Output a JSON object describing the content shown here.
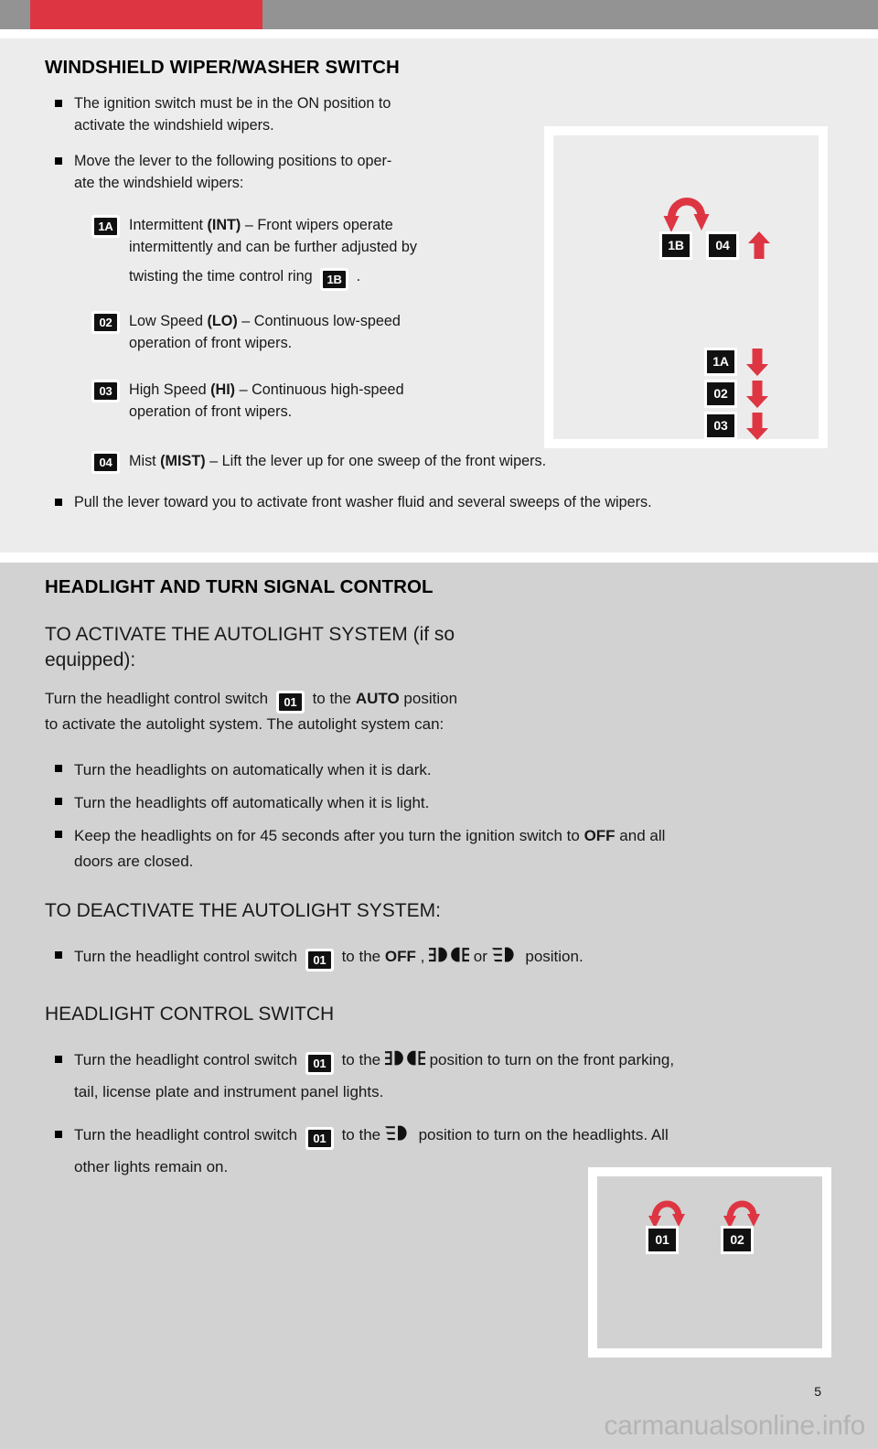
{
  "header": {
    "bar_color": "#939393",
    "accent_color": "#de3543"
  },
  "wiper_section": {
    "title": "WINDSHIELD WIPER/WASHER SWITCH",
    "bullets": [
      {
        "text_1": "The ignition switch must be in the ON position to",
        "text_2": "activate the windshield wipers."
      },
      {
        "text_1": "Move the lever to the following positions to oper-",
        "text_2": "ate the windshield wipers:"
      }
    ],
    "positions": [
      {
        "badge": "1A",
        "line_1_a": "Intermittent ",
        "line_1_bold": "(INT)",
        "line_1_b": " – Front wipers operate",
        "line_2": "intermittently and can be further adjusted by",
        "line_3_a": "twisting the time control ring",
        "inline_badge": "1B",
        "line_3_b": "."
      },
      {
        "badge": "02",
        "line_1_a": "Low Speed ",
        "line_1_bold": "(LO)",
        "line_1_b": " – Continuous low-speed",
        "line_2": "operation of front wipers."
      },
      {
        "badge": "03",
        "line_1_a": "High Speed ",
        "line_1_bold": "(HI)",
        "line_1_b": " – Continuous high-speed",
        "line_2": "operation of front wipers."
      },
      {
        "badge": "04",
        "line_1_a": "Mist ",
        "line_1_bold": "(MIST)",
        "line_1_b": " – Lift the lever up for one sweep of the front wipers."
      }
    ],
    "final_bullet": "Pull the lever toward you to activate front washer fluid and several sweeps of the wipers.",
    "figure": {
      "name": "wiper-lever-diagram",
      "items": [
        {
          "badge": "1B",
          "arrow": "curved-u-turn-arrow"
        },
        {
          "badge": "04",
          "arrow": "up-arrow"
        },
        {
          "badge": "1A",
          "arrow": "down-arrow"
        },
        {
          "badge": "02",
          "arrow": "down-arrow"
        },
        {
          "badge": "03",
          "arrow": "down-arrow"
        }
      ]
    }
  },
  "headlight_section": {
    "title": "HEADLIGHT AND TURN SIGNAL CONTROL",
    "activate_heading_line1": "TO ACTIVATE THE AUTOLIGHT SYSTEM (if so",
    "activate_heading_line2": "equipped):",
    "activate_para": {
      "a": "Turn the headlight control switch",
      "badge": "01",
      "b": "to the ",
      "bold": "AUTO",
      "c": " position",
      "line2": "to activate the autolight system. The autolight system can:"
    },
    "activate_bullets": [
      {
        "text": "Turn the headlights on automatically when it is dark."
      },
      {
        "text": "Turn the headlights off automatically when it is light."
      },
      {
        "a": "Keep the headlights on for 45 seconds after you turn the ignition switch to ",
        "bold": "OFF",
        "b": " and all",
        "line2": "doors are closed."
      }
    ],
    "deactivate_heading": "TO DEACTIVATE THE AUTOLIGHT SYSTEM:",
    "deactivate_bullet": {
      "a": "Turn the headlight control switch",
      "badge": "01",
      "b": "to the ",
      "bold": "OFF",
      "c": " ,",
      "icon_1": "parking-light-icon",
      "d": "or",
      "icon_2": "headlight-icon",
      "e": "position."
    },
    "control_heading": "HEADLIGHT CONTROL SWITCH",
    "control_bullets": [
      {
        "a": "Turn the headlight control switch",
        "badge": "01",
        "b": "to the",
        "icon": "parking-light-icon",
        "c": "position to turn on the front parking,",
        "line2": "tail, license plate and instrument panel lights."
      },
      {
        "a": "Turn the headlight control switch",
        "badge": "01",
        "b": "to the",
        "icon": "headlight-icon",
        "c": "position to turn on the headlights. All",
        "line2": "other lights remain on."
      }
    ],
    "figure": {
      "name": "headlight-switch-diagram",
      "items": [
        {
          "badge": "01",
          "arrow": "curved-u-turn-arrow"
        },
        {
          "badge": "02",
          "arrow": "curved-u-turn-arrow"
        }
      ]
    }
  },
  "footer": {
    "page_number": "5",
    "watermark": "carmanualsonline.info"
  }
}
